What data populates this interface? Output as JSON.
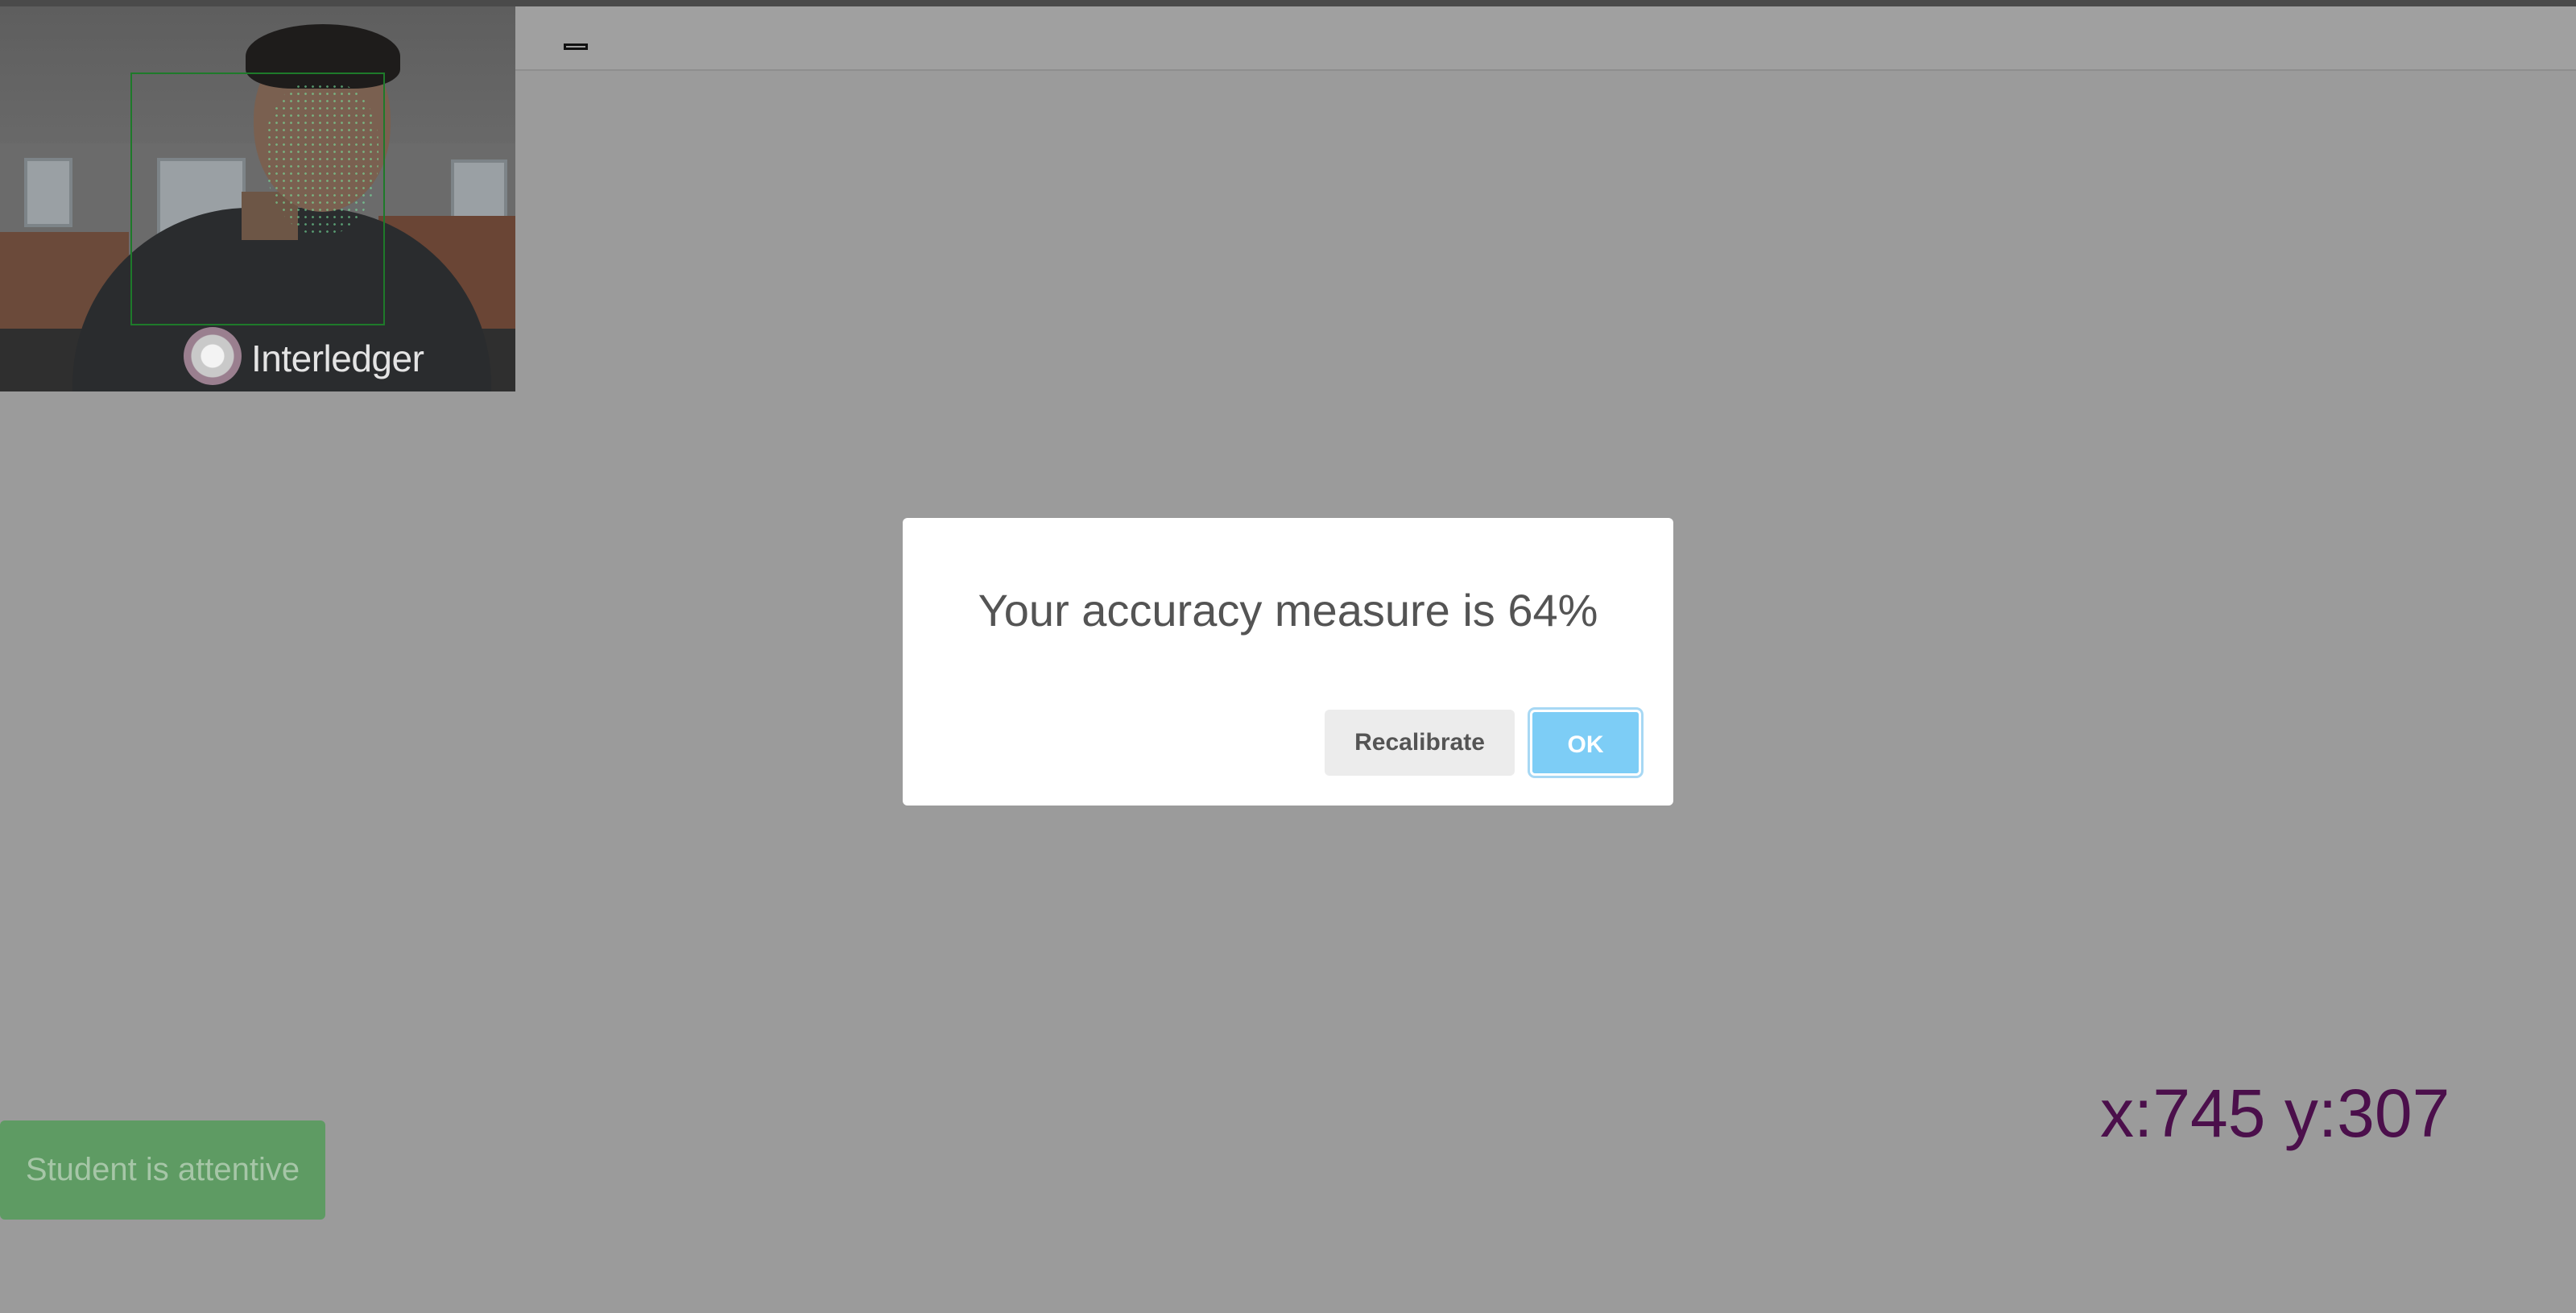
{
  "webcam": {
    "shirt_text": "Interledger"
  },
  "dialog": {
    "title": "Your accuracy measure is 64%",
    "recalibrate_label": "Recalibrate",
    "ok_label": "OK"
  },
  "status": {
    "text": "Student is attentive"
  },
  "gaze": {
    "readout": "x:745 y:307"
  },
  "colors": {
    "overlay": "#9b9b9b",
    "ok_button": "#7dcdf6",
    "status_badge": "#5e9b63",
    "readout_text": "#4b0f4b"
  }
}
